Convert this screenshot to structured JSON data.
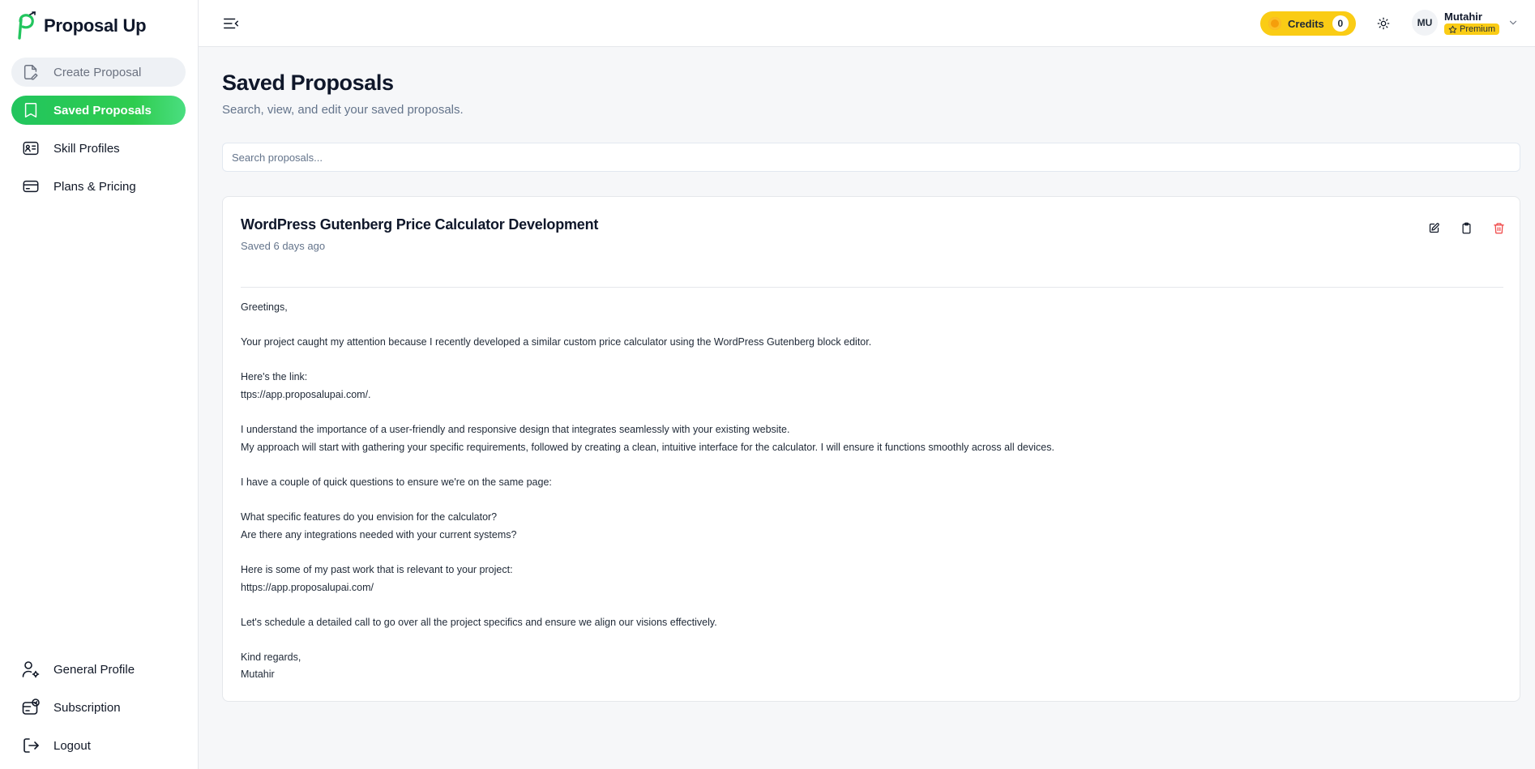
{
  "app": {
    "name": "Proposal Up"
  },
  "sidebar": {
    "items": [
      {
        "label": "Create Proposal",
        "icon": "file-edit-icon",
        "state": "muted"
      },
      {
        "label": "Saved Proposals",
        "icon": "bookmark-icon",
        "state": "active"
      },
      {
        "label": "Skill Profiles",
        "icon": "id-card-icon",
        "state": "normal"
      },
      {
        "label": "Plans & Pricing",
        "icon": "credit-card-icon",
        "state": "normal"
      }
    ],
    "bottom_items": [
      {
        "label": "General Profile",
        "icon": "user-gear-icon"
      },
      {
        "label": "Subscription",
        "icon": "subscription-icon"
      },
      {
        "label": "Logout",
        "icon": "logout-icon"
      }
    ]
  },
  "header": {
    "credits_label": "Credits",
    "credits_count": "0",
    "user": {
      "initials": "MU",
      "name": "Mutahir",
      "plan": "Premium"
    }
  },
  "page": {
    "title": "Saved Proposals",
    "subtitle": "Search, view, and edit your saved proposals.",
    "search_placeholder": "Search proposals..."
  },
  "proposals": [
    {
      "title": "WordPress Gutenberg Price Calculator Development",
      "saved": "Saved 6 days ago",
      "body": [
        "Greetings,",
        "",
        "Your project caught my attention because I recently developed a similar custom price calculator using the WordPress Gutenberg block editor.",
        "",
        "Here's the link:",
        "ttps://app.proposalupai.com/.",
        "",
        "I understand the importance of a user-friendly and responsive design that integrates seamlessly with your existing website.",
        "My approach will start with gathering your specific requirements, followed by creating a clean, intuitive interface for the calculator. I will ensure it functions smoothly across all devices.",
        "",
        "I have a couple of quick questions to ensure we're on the same page:",
        "",
        "What specific features do you envision for the calculator?",
        "Are there any integrations needed with your current systems?",
        "",
        "Here is some of my past work that is relevant to your project:",
        "https://app.proposalupai.com/",
        "",
        "Let's schedule a detailed call to go over all the project specifics and ensure we align our visions effectively.",
        "",
        "Kind regards,",
        "Mutahir"
      ]
    }
  ],
  "colors": {
    "accent_green": "#22c55e",
    "credits_yellow": "#facc15",
    "delete_red": "#ef4444"
  }
}
